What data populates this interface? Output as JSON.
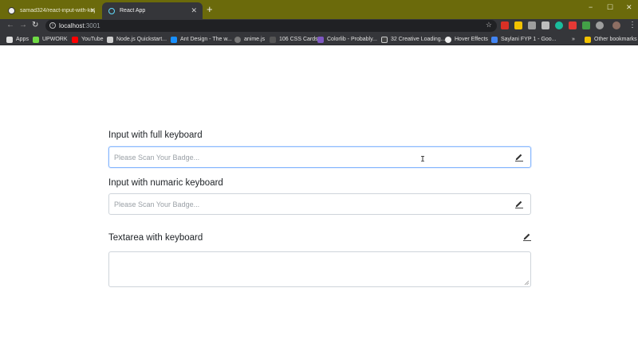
{
  "browser": {
    "tabs": [
      {
        "title": "samad324/react-input-with-key"
      },
      {
        "title": "React App"
      }
    ],
    "new_tab": "+",
    "window_controls": {
      "minimize": "−",
      "maximize": "☐",
      "close": "✕"
    },
    "url_host": "localhost",
    "url_port": ":3001",
    "bookmarks": [
      {
        "label": "Apps",
        "icon": "apps-grid-icon"
      },
      {
        "label": "UPWORK",
        "icon": "upwork-icon"
      },
      {
        "label": "YouTube",
        "icon": "youtube-icon"
      },
      {
        "label": "Node.js Quickstart...",
        "icon": "document-icon"
      },
      {
        "label": "Ant Design - The w...",
        "icon": "ant-design-icon"
      },
      {
        "label": "anime.js",
        "icon": "anime-icon"
      },
      {
        "label": "106 CSS Cards",
        "icon": "f-icon"
      },
      {
        "label": "Colorlib - Probably...",
        "icon": "colorlib-icon"
      },
      {
        "label": "32 Creative Loading...",
        "icon": "codepen-icon"
      },
      {
        "label": "Hover Effects",
        "icon": "github-icon"
      },
      {
        "label": "Saylani FYP 1 - Goo...",
        "icon": "google-docs-icon"
      }
    ],
    "bookmarks_more": "»",
    "other_bookmarks": "Other bookmarks"
  },
  "form": {
    "full_keyboard": {
      "label": "Input with full keyboard",
      "placeholder": "Please Scan Your Badge...",
      "value": ""
    },
    "numeric_keyboard": {
      "label": "Input with numaric keyboard",
      "placeholder": "Please Scan Your Badge...",
      "value": ""
    },
    "textarea_keyboard": {
      "label": "Textarea with keyboard",
      "value": ""
    }
  },
  "colors": {
    "tabstrip": "#6b6a0b",
    "toolbar": "#35363a",
    "focus_border": "#86b7fe",
    "input_border": "#ced4da"
  }
}
